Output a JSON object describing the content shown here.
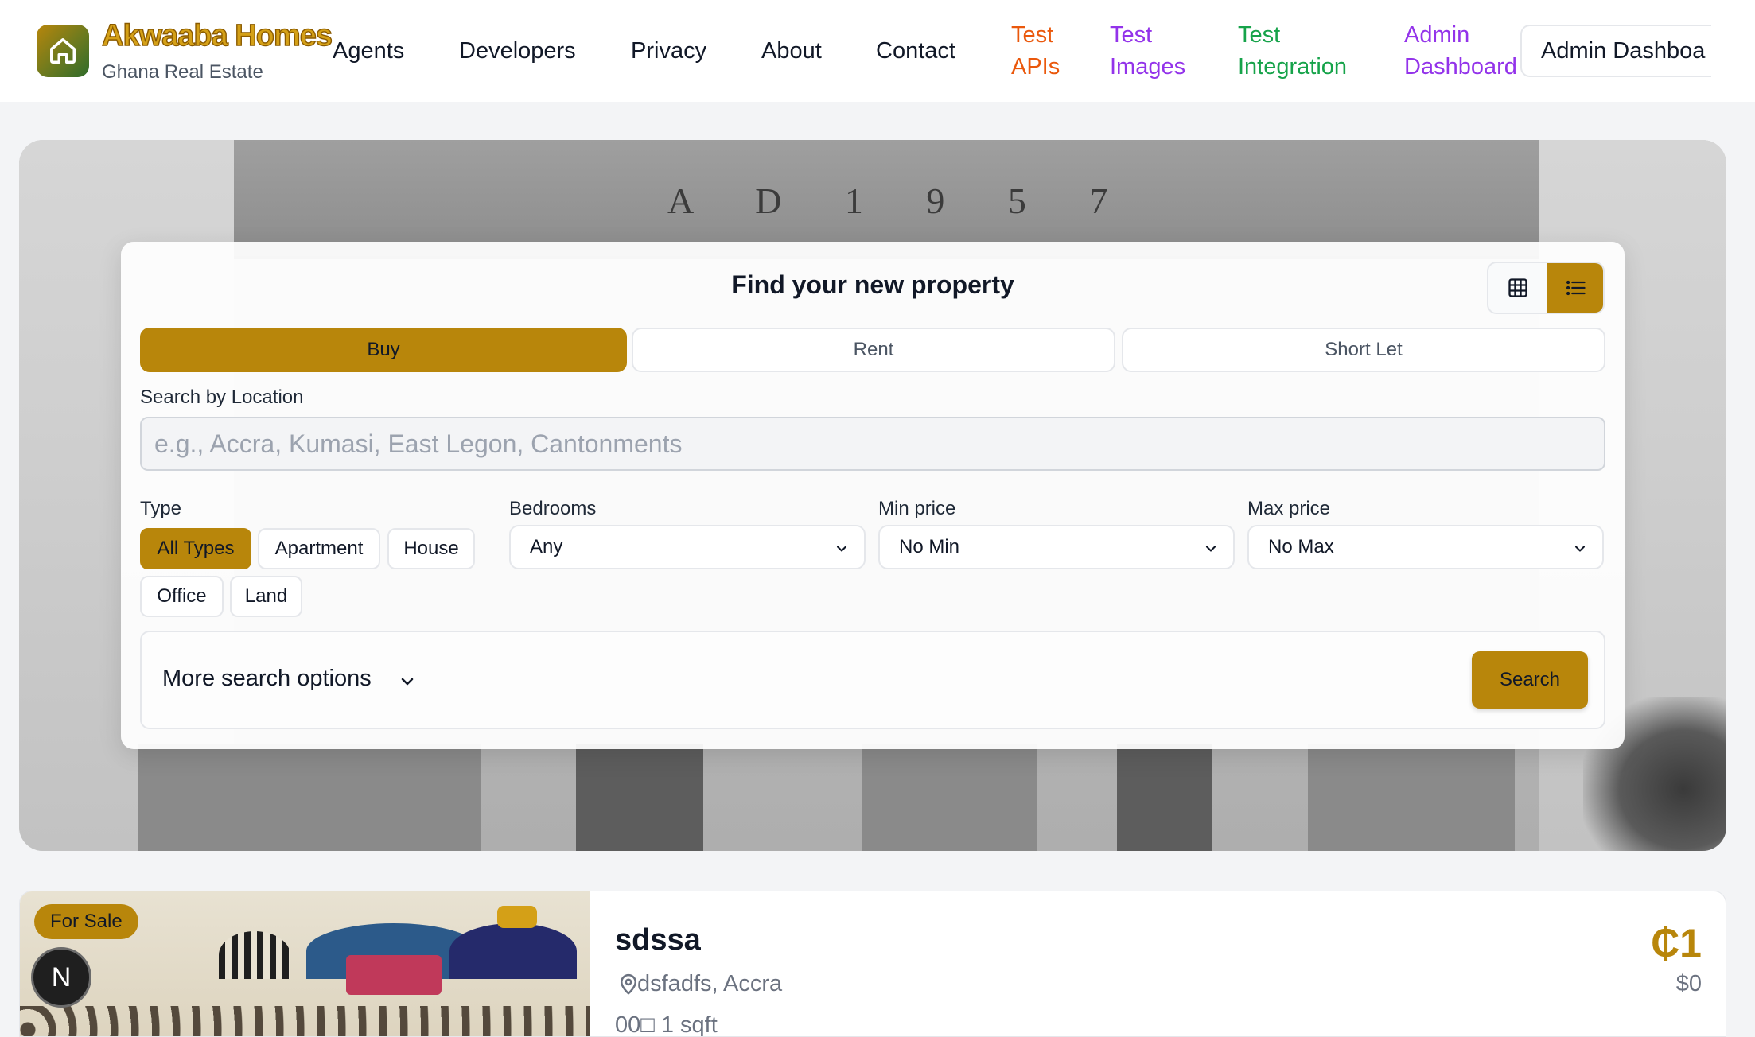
{
  "header": {
    "brand_name": "Akwaaba Homes",
    "brand_sub": "Ghana Real Estate",
    "logo_icon": "home-icon",
    "nav": [
      {
        "label": "Agents"
      },
      {
        "label": "Developers"
      },
      {
        "label": "Privacy"
      },
      {
        "label": "About"
      },
      {
        "label": "Contact"
      },
      {
        "label": "Test APIs",
        "color": "#ea580c"
      },
      {
        "label": "Test Images",
        "color": "#9333ea"
      },
      {
        "label": "Test Integration",
        "color": "#16a34a"
      },
      {
        "label": "Admin Dashboard",
        "color": "#9333ea"
      }
    ],
    "admin_button": "Admin Dashboa"
  },
  "hero": {
    "inscription": "A D   1 9 5 7"
  },
  "search": {
    "title": "Find your new property",
    "view_icons": [
      "grid-icon",
      "list-icon"
    ],
    "tabs": [
      {
        "label": "Buy",
        "active": true
      },
      {
        "label": "Rent",
        "active": false
      },
      {
        "label": "Short Let",
        "active": false
      }
    ],
    "location_label": "Search by Location",
    "location_placeholder": "e.g., Accra, Kumasi, East Legon, Cantonments",
    "type_label": "Type",
    "types": [
      {
        "label": "All Types",
        "active": true
      },
      {
        "label": "Apartment",
        "active": false
      },
      {
        "label": "House",
        "active": false
      },
      {
        "label": "Office",
        "active": false
      },
      {
        "label": "Land",
        "active": false
      }
    ],
    "bedrooms_label": "Bedrooms",
    "bedrooms_value": "Any",
    "min_price_label": "Min price",
    "min_price_value": "No Min",
    "max_price_label": "Max price",
    "max_price_value": "No Max",
    "more_options": "More search options",
    "search_button": "Search"
  },
  "listing": {
    "badge": "For Sale",
    "avatar_letter": "N",
    "title": "sdssa",
    "location": "dsfadfs, Accra",
    "meta": "00□ 1 sqft",
    "price": "₵1",
    "price_usd": "$0"
  },
  "colors": {
    "accent": "#b8860b",
    "test_apis": "#ea580c",
    "test_images": "#9333ea",
    "test_integration": "#16a34a",
    "admin_dashboard": "#9333ea"
  }
}
